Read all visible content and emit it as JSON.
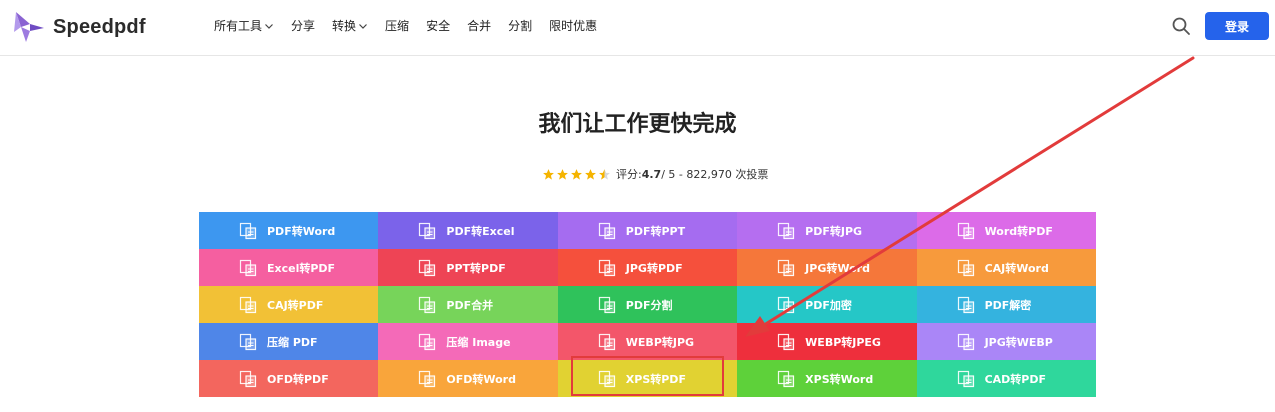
{
  "header": {
    "logo_text": "Speedpdf",
    "nav": [
      {
        "label": "所有工具",
        "dropdown": true
      },
      {
        "label": "分享",
        "dropdown": false
      },
      {
        "label": "转换",
        "dropdown": true
      },
      {
        "label": "压缩",
        "dropdown": false
      },
      {
        "label": "安全",
        "dropdown": false
      },
      {
        "label": "合并",
        "dropdown": false
      },
      {
        "label": "分割",
        "dropdown": false
      },
      {
        "label": "限时优惠",
        "dropdown": false
      }
    ],
    "login_label": "登录",
    "accent": "#2563eb"
  },
  "hero": {
    "title": "我们让工作更快完成",
    "rating_prefix": "评分: ",
    "rating_value": "4.7",
    "rating_suffix": " / 5 - 822,970 次投票",
    "stars": 4.5
  },
  "tools": [
    {
      "label": "PDF转Word",
      "color": "#3d97f0"
    },
    {
      "label": "PDF转Excel",
      "color": "#7b63ea"
    },
    {
      "label": "PDF转PPT",
      "color": "#a56cf0"
    },
    {
      "label": "PDF转JPG",
      "color": "#b56ef0"
    },
    {
      "label": "Word转PDF",
      "color": "#dc6be8"
    },
    {
      "label": "Excel转PDF",
      "color": "#f55fa0"
    },
    {
      "label": "PPT转PDF",
      "color": "#ee4455"
    },
    {
      "label": "JPG转PDF",
      "color": "#f5503c"
    },
    {
      "label": "JPG转Word",
      "color": "#f5773a"
    },
    {
      "label": "CAJ转Word",
      "color": "#f79a3c"
    },
    {
      "label": "CAJ转PDF",
      "color": "#f2c136"
    },
    {
      "label": "PDF合并",
      "color": "#77d45a"
    },
    {
      "label": "PDF分割",
      "color": "#2fc25b"
    },
    {
      "label": "PDF加密",
      "color": "#25c7c7"
    },
    {
      "label": "PDF解密",
      "color": "#34b3df"
    },
    {
      "label": "压缩 PDF",
      "color": "#4f86e8"
    },
    {
      "label": "压缩 Image",
      "color": "#f46ab8"
    },
    {
      "label": "WEBP转JPG",
      "color": "#f3566a"
    },
    {
      "label": "WEBP转JPEG",
      "color": "#ee2f3c"
    },
    {
      "label": "JPG转WEBP",
      "color": "#aa86f7"
    },
    {
      "label": "OFD转PDF",
      "color": "#f3665e"
    },
    {
      "label": "OFD转Word",
      "color": "#f9a53b"
    },
    {
      "label": "XPS转PDF",
      "color": "#e1d232"
    },
    {
      "label": "XPS转Word",
      "color": "#5ed13a"
    },
    {
      "label": "CAD转PDF",
      "color": "#2fd79c"
    }
  ],
  "annotation": {
    "highlight_color": "#e23b3b"
  }
}
